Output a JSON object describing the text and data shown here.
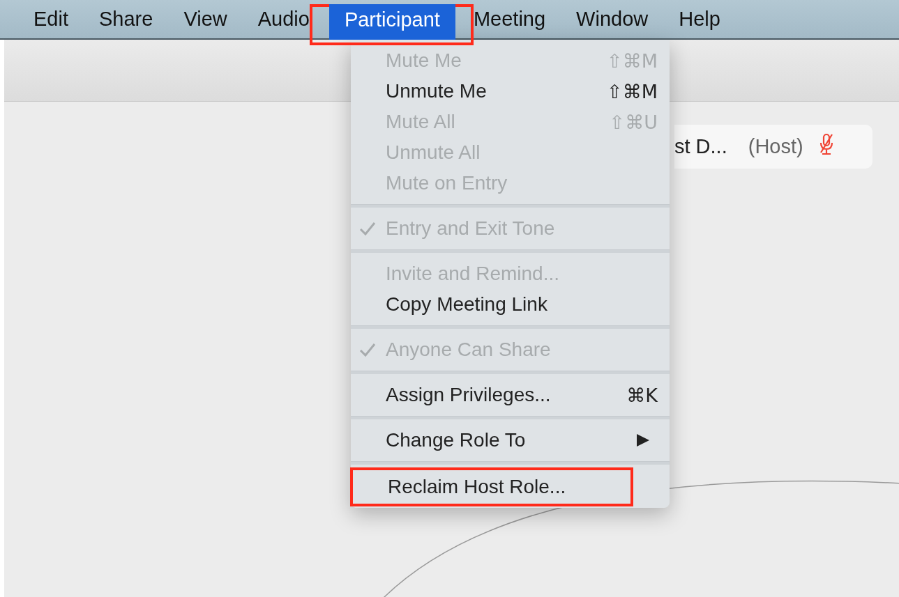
{
  "menu_bar": {
    "items": [
      {
        "label": "Edit",
        "selected": false,
        "callout": false
      },
      {
        "label": "Share",
        "selected": false,
        "callout": false
      },
      {
        "label": "View",
        "selected": false,
        "callout": false
      },
      {
        "label": "Audio",
        "selected": false,
        "callout": false
      },
      {
        "label": "Participant",
        "selected": true,
        "callout": true
      },
      {
        "label": "Meeting",
        "selected": false,
        "callout": false
      },
      {
        "label": "Window",
        "selected": false,
        "callout": false
      },
      {
        "label": "Help",
        "selected": false,
        "callout": false
      }
    ]
  },
  "menu": {
    "groups": [
      {
        "items": [
          {
            "kind": "command",
            "label": "Mute Me",
            "shortcut": "⇧⌘M",
            "disabled": true,
            "checked": false,
            "callout": false
          },
          {
            "kind": "command",
            "label": "Unmute Me",
            "shortcut": "⇧⌘M",
            "disabled": false,
            "checked": false,
            "callout": false
          },
          {
            "kind": "command",
            "label": "Mute All",
            "shortcut": "⇧⌘U",
            "disabled": true,
            "checked": false,
            "callout": false
          },
          {
            "kind": "command",
            "label": "Unmute All",
            "disabled": true,
            "checked": false,
            "callout": false
          },
          {
            "kind": "command",
            "label": "Mute on Entry",
            "disabled": true,
            "checked": false,
            "callout": false
          }
        ]
      },
      {
        "items": [
          {
            "kind": "command",
            "label": "Entry and Exit Tone",
            "disabled": true,
            "checked": true,
            "callout": false
          }
        ]
      },
      {
        "items": [
          {
            "kind": "command",
            "label": "Invite and Remind...",
            "disabled": true,
            "checked": false,
            "callout": false
          },
          {
            "kind": "command",
            "label": "Copy Meeting Link",
            "disabled": false,
            "checked": false,
            "callout": false
          }
        ]
      },
      {
        "items": [
          {
            "kind": "command",
            "label": "Anyone Can Share",
            "disabled": true,
            "checked": true,
            "callout": false
          }
        ]
      },
      {
        "items": [
          {
            "kind": "command",
            "label": "Assign Privileges...",
            "shortcut": "⌘K",
            "disabled": false,
            "checked": false,
            "callout": false
          }
        ]
      },
      {
        "items": [
          {
            "kind": "submenu",
            "label": "Change Role To",
            "disabled": false,
            "checked": false,
            "callout": false
          }
        ]
      },
      {
        "items": [
          {
            "kind": "command",
            "label": "Reclaim Host Role...",
            "disabled": false,
            "checked": false,
            "callout": true
          }
        ]
      }
    ]
  },
  "participant_chip": {
    "name": "st D...",
    "role": "(Host)",
    "muted": true
  }
}
